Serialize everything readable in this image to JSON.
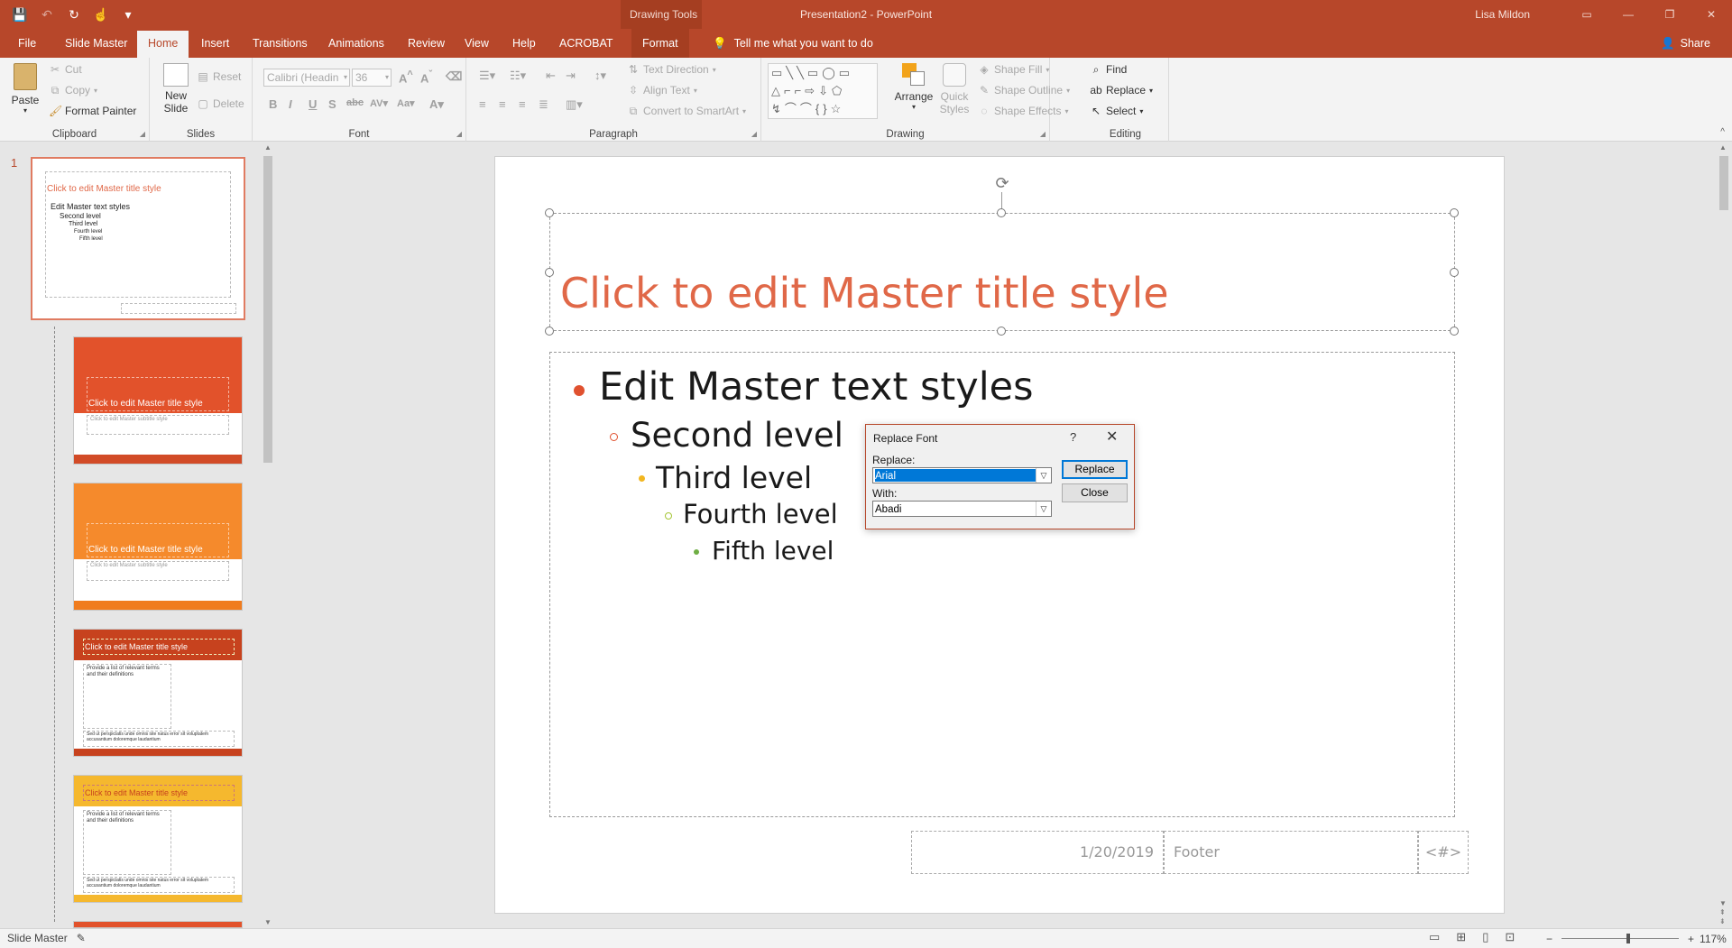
{
  "app": {
    "window_title": "Presentation2  -  PowerPoint",
    "context_label": "Drawing Tools",
    "user": "Lisa Mildon"
  },
  "qat": {
    "save": "💾",
    "undo": "↶",
    "redo": "↻",
    "touch": "☝",
    "customize": "▾"
  },
  "tabs": [
    {
      "label": "File"
    },
    {
      "label": "Slide Master"
    },
    {
      "label": "Home"
    },
    {
      "label": "Insert"
    },
    {
      "label": "Transitions"
    },
    {
      "label": "Animations"
    },
    {
      "label": "Review"
    },
    {
      "label": "View"
    },
    {
      "label": "Help"
    },
    {
      "label": "ACROBAT"
    },
    {
      "label": "Format"
    }
  ],
  "active_tab": "Home",
  "tell_me": "Tell me what you want to do",
  "share": "Share",
  "ribbon": {
    "clipboard": {
      "label": "Clipboard",
      "paste": "Paste",
      "cut": "Cut",
      "copy": "Copy",
      "format_painter": "Format Painter"
    },
    "slides": {
      "label": "Slides",
      "new_slide": "New",
      "new_slide2": "Slide",
      "reset": "Reset",
      "delete": "Delete"
    },
    "font": {
      "label": "Font",
      "font_name": "Calibri (Headin",
      "font_size": "36"
    },
    "paragraph": {
      "label": "Paragraph",
      "text_direction": "Text Direction",
      "align_text": "Align Text",
      "convert_smartart": "Convert to SmartArt"
    },
    "drawing": {
      "label": "Drawing",
      "arrange": "Arrange",
      "quick_styles": "Quick",
      "quick_styles2": "Styles",
      "shape_fill": "Shape Fill",
      "shape_outline": "Shape Outline",
      "shape_effects": "Shape Effects"
    },
    "editing": {
      "label": "Editing",
      "find": "Find",
      "replace": "Replace",
      "select": "Select"
    }
  },
  "thumbnails": {
    "number": "1",
    "master_title": "Click to edit Master title style",
    "master_body": [
      "Edit Master text styles",
      "Second level",
      "Third level",
      "Fourth level",
      "Fifth level"
    ],
    "layout_title": "Click to edit Master title style",
    "layout_subtitle": "Click to edit Master subtitle style",
    "layout_terms": "Provide a list of relevant terms and their definitions",
    "layout_lorem": "Sed ut perspiciatis unde omnis iste natus error sit voluptatem accusantium doloremque laudantium"
  },
  "slide": {
    "title": "Click to edit Master title style",
    "levels": [
      "Edit Master text styles",
      "Second level",
      "Third level",
      "Fourth level",
      "Fifth level"
    ],
    "date": "1/20/2019",
    "footer": "Footer",
    "slide_number": "<#>"
  },
  "dialog": {
    "title": "Replace Font",
    "help": "?",
    "close_x": "✕",
    "replace_label": "Replace:",
    "replace_value": "Arial",
    "with_label": "With:",
    "with_value": "Abadi",
    "replace_button": "Replace",
    "close_button": "Close"
  },
  "status": {
    "mode": "Slide Master",
    "zoom": "117%"
  },
  "colors": {
    "accent": "#b7472a",
    "title_text": "#e06848",
    "bullet1": "#e0512f",
    "bullet3": "#f2b620",
    "bullet4": "#a5c534",
    "bullet5": "#6fae44"
  }
}
